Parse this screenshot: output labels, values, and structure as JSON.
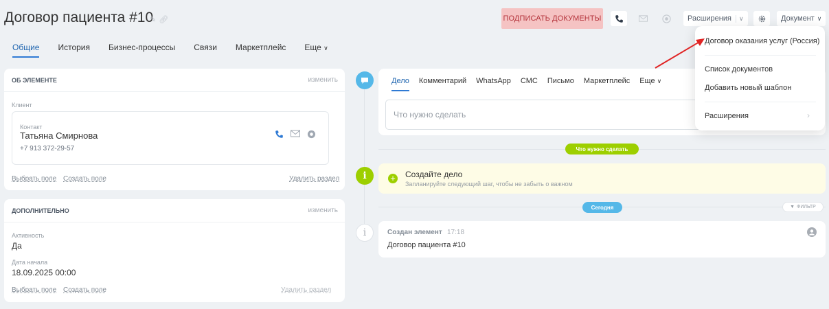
{
  "header": {
    "title": "Договор пациента #10",
    "sign_button": "ПОДПИСАТЬ ДОКУМЕНТЫ",
    "extensions_button": "Расширения",
    "document_button": "Документ"
  },
  "tabs": [
    {
      "label": "Общие",
      "active": true
    },
    {
      "label": "История"
    },
    {
      "label": "Бизнес-процессы"
    },
    {
      "label": "Связи"
    },
    {
      "label": "Маркетплейс"
    },
    {
      "label": "Еще"
    }
  ],
  "about": {
    "title": "ОБ ЭЛЕМЕНТЕ",
    "edit": "изменить",
    "client_label": "Клиент",
    "contact_label": "Контакт",
    "contact_name": "Татьяна Смирнова",
    "contact_phone": "+7 913 372-29-57",
    "select_field": "Выбрать поле",
    "create_field": "Создать поле",
    "delete_section": "Удалить раздел"
  },
  "additional": {
    "title": "ДОПОЛНИТЕЛЬНО",
    "edit": "изменить",
    "activity_label": "Активность",
    "activity_value": "Да",
    "start_label": "Дата начала",
    "start_value": "18.09.2025 00:00",
    "select_field": "Выбрать поле",
    "create_field": "Создать поле",
    "delete_section": "Удалить раздел"
  },
  "activity": {
    "tabs": [
      "Дело",
      "Комментарий",
      "WhatsApp",
      "СМС",
      "Письмо",
      "Маркетплейс",
      "Еще"
    ],
    "placeholder": "Что нужно сделать"
  },
  "timeline": {
    "todo_pill": "Что нужно сделать",
    "create_title": "Создайте дело",
    "create_sub": "Запланируйте следующий шаг, чтобы не забыть о важном",
    "today_pill": "Сегодня",
    "filter": "ФИЛЬТР",
    "event_title": "Создан элемент",
    "event_time": "17:18",
    "event_text": "Договор пациента #10"
  },
  "menu": {
    "item1": "Договор оказания услуг (Россия)",
    "item2": "Список документов",
    "item3": "Добавить новый шаблон",
    "item4": "Расширения"
  },
  "colors": {
    "accent_blue": "#2f7ad4",
    "sign_bg": "#f5c3c3",
    "sign_text": "#b4333b",
    "green": "#9dcf00",
    "timeline_blue": "#55b8e8",
    "arrow_red": "#e02424"
  }
}
